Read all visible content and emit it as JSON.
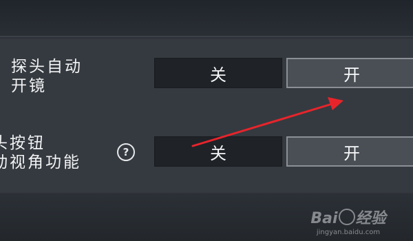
{
  "settings": [
    {
      "label_lines": [
        "探头自动",
        "开镜"
      ],
      "off_label": "关",
      "on_label": "开",
      "selected": "on",
      "has_help": false
    },
    {
      "label_lines": [
        "头按钮",
        "动视角功能"
      ],
      "off_label": "关",
      "on_label": "开",
      "selected": "on",
      "has_help": true,
      "help_icon": "question-circle-icon"
    }
  ],
  "annotation": {
    "type": "arrow",
    "color": "#e8242b"
  },
  "watermark": {
    "brand": "Bai",
    "brand_suffix": "经验",
    "url": "jingyan.baidu.com"
  },
  "colors": {
    "background": "#2e3238",
    "panel": "#353a40",
    "toggle_off_bg": "#1f2328",
    "toggle_on_bg": "#4a4f56",
    "toggle_on_border": "#8c9096",
    "text": "#eef0f2"
  }
}
